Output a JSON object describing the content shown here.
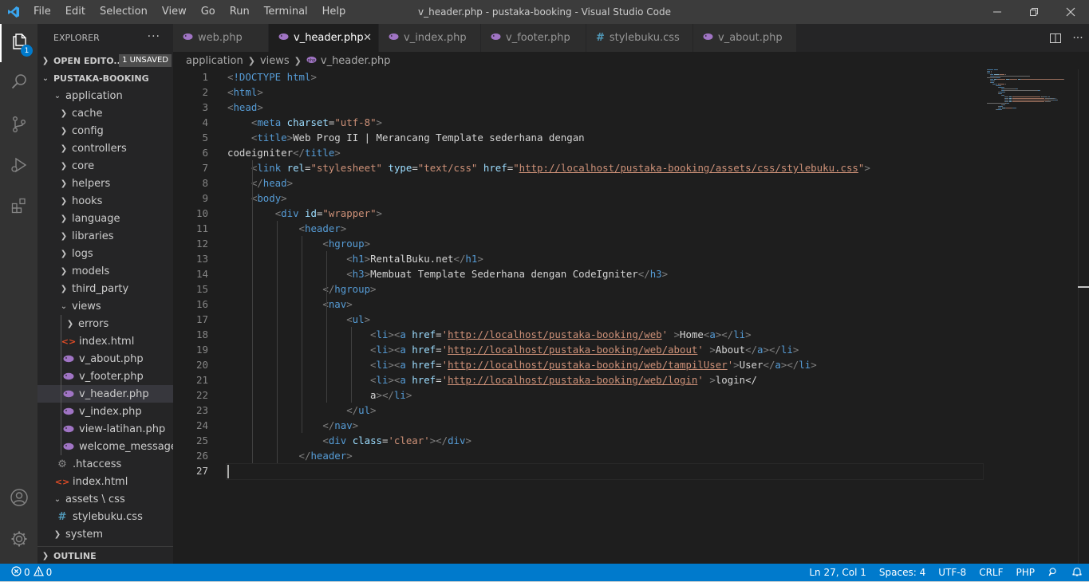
{
  "window": {
    "title": "v_header.php - pustaka-booking - Visual Studio Code",
    "menu": [
      "File",
      "Edit",
      "Selection",
      "View",
      "Go",
      "Run",
      "Terminal",
      "Help"
    ]
  },
  "activity": {
    "explorer_badge": "1"
  },
  "sidebar": {
    "title": "EXPLORER",
    "open_editors": "OPEN EDITO...",
    "unsaved": "1 UNSAVED",
    "project": "PUSTAKA-BOOKING",
    "outline": "OUTLINE",
    "tree": [
      {
        "label": "application",
        "type": "folder-open",
        "depth": 1
      },
      {
        "label": "cache",
        "type": "folder",
        "depth": 2
      },
      {
        "label": "config",
        "type": "folder",
        "depth": 2
      },
      {
        "label": "controllers",
        "type": "folder",
        "depth": 2
      },
      {
        "label": "core",
        "type": "folder",
        "depth": 2
      },
      {
        "label": "helpers",
        "type": "folder",
        "depth": 2
      },
      {
        "label": "hooks",
        "type": "folder",
        "depth": 2
      },
      {
        "label": "language",
        "type": "folder",
        "depth": 2
      },
      {
        "label": "libraries",
        "type": "folder",
        "depth": 2
      },
      {
        "label": "logs",
        "type": "folder",
        "depth": 2
      },
      {
        "label": "models",
        "type": "folder",
        "depth": 2
      },
      {
        "label": "third_party",
        "type": "folder",
        "depth": 2
      },
      {
        "label": "views",
        "type": "folder-open",
        "depth": 2
      },
      {
        "label": "errors",
        "type": "folder",
        "depth": 3
      },
      {
        "label": "index.html",
        "type": "html",
        "depth": 3
      },
      {
        "label": "v_about.php",
        "type": "php",
        "depth": 3
      },
      {
        "label": "v_footer.php",
        "type": "php",
        "depth": 3
      },
      {
        "label": "v_header.php",
        "type": "php",
        "depth": 3,
        "selected": true
      },
      {
        "label": "v_index.php",
        "type": "php",
        "depth": 3
      },
      {
        "label": "view-latihan.php",
        "type": "php",
        "depth": 3
      },
      {
        "label": "welcome_message....",
        "type": "php",
        "depth": 3
      },
      {
        "label": ".htaccess",
        "type": "gear",
        "depth": 2
      },
      {
        "label": "index.html",
        "type": "html",
        "depth": 2
      },
      {
        "label": "assets \\ css",
        "type": "folder-open",
        "depth": 1
      },
      {
        "label": "stylebuku.css",
        "type": "css",
        "depth": 2
      },
      {
        "label": "system",
        "type": "folder",
        "depth": 1
      }
    ]
  },
  "tabs": [
    {
      "label": "web.php",
      "type": "php",
      "width": 120
    },
    {
      "label": "v_header.php",
      "type": "php",
      "width": 138,
      "active": true
    },
    {
      "label": "v_index.php",
      "type": "php",
      "width": 128
    },
    {
      "label": "v_footer.php",
      "type": "php",
      "width": 132
    },
    {
      "label": "stylebuku.css",
      "type": "css",
      "width": 134
    },
    {
      "label": "v_about.php",
      "type": "php",
      "width": 130
    }
  ],
  "breadcrumb": [
    "application",
    "views",
    "v_header.php"
  ],
  "editor": {
    "current_line": 27,
    "lines": [
      [
        [
          "br",
          "<"
        ],
        [
          "tag",
          "!DOCTYPE"
        ],
        [
          "txt",
          " "
        ],
        [
          "tag",
          "html"
        ],
        [
          "br",
          ">"
        ]
      ],
      [
        [
          "br",
          "<"
        ],
        [
          "tag",
          "html"
        ],
        [
          "br",
          ">"
        ]
      ],
      [
        [
          "br",
          "<"
        ],
        [
          "tag",
          "head"
        ],
        [
          "br",
          ">"
        ]
      ],
      [
        [
          "txt",
          "    "
        ],
        [
          "br",
          "<"
        ],
        [
          "tag",
          "meta"
        ],
        [
          "txt",
          " "
        ],
        [
          "attr",
          "charset"
        ],
        [
          "txt",
          "="
        ],
        [
          "str",
          "\"utf-8\""
        ],
        [
          "br",
          ">"
        ]
      ],
      [
        [
          "txt",
          "    "
        ],
        [
          "br",
          "<"
        ],
        [
          "tag",
          "title"
        ],
        [
          "br",
          ">"
        ],
        [
          "txt",
          "Web Prog II | Merancang Template sederhana dengan"
        ]
      ],
      [
        [
          "txt",
          "codeigniter"
        ],
        [
          "br",
          "</"
        ],
        [
          "tag",
          "title"
        ],
        [
          "br",
          ">"
        ]
      ],
      [
        [
          "txt",
          "    "
        ],
        [
          "br",
          "<"
        ],
        [
          "tag",
          "link"
        ],
        [
          "txt",
          " "
        ],
        [
          "attr",
          "rel"
        ],
        [
          "txt",
          "="
        ],
        [
          "str",
          "\"stylesheet\""
        ],
        [
          "txt",
          " "
        ],
        [
          "attr",
          "type"
        ],
        [
          "txt",
          "="
        ],
        [
          "str",
          "\"text/css\""
        ],
        [
          "txt",
          " "
        ],
        [
          "attr",
          "href"
        ],
        [
          "txt",
          "="
        ],
        [
          "str",
          "\""
        ],
        [
          "url",
          "http://localhost/pustaka-booking/assets/css/stylebuku.css"
        ],
        [
          "str",
          "\""
        ],
        [
          "br",
          ">"
        ]
      ],
      [
        [
          "txt",
          "    "
        ],
        [
          "br",
          "</"
        ],
        [
          "tag",
          "head"
        ],
        [
          "br",
          ">"
        ]
      ],
      [
        [
          "txt",
          "    "
        ],
        [
          "br",
          "<"
        ],
        [
          "tag",
          "body"
        ],
        [
          "br",
          ">"
        ]
      ],
      [
        [
          "txt",
          "        "
        ],
        [
          "br",
          "<"
        ],
        [
          "tag",
          "div"
        ],
        [
          "txt",
          " "
        ],
        [
          "attr",
          "id"
        ],
        [
          "txt",
          "="
        ],
        [
          "str",
          "\"wrapper\""
        ],
        [
          "br",
          ">"
        ]
      ],
      [
        [
          "txt",
          "            "
        ],
        [
          "br",
          "<"
        ],
        [
          "tag",
          "header"
        ],
        [
          "br",
          ">"
        ]
      ],
      [
        [
          "txt",
          "                "
        ],
        [
          "br",
          "<"
        ],
        [
          "tag",
          "hgroup"
        ],
        [
          "br",
          ">"
        ]
      ],
      [
        [
          "txt",
          "                    "
        ],
        [
          "br",
          "<"
        ],
        [
          "tag",
          "h1"
        ],
        [
          "br",
          ">"
        ],
        [
          "txt",
          "RentalBuku.net"
        ],
        [
          "br",
          "</"
        ],
        [
          "tag",
          "h1"
        ],
        [
          "br",
          ">"
        ]
      ],
      [
        [
          "txt",
          "                    "
        ],
        [
          "br",
          "<"
        ],
        [
          "tag",
          "h3"
        ],
        [
          "br",
          ">"
        ],
        [
          "txt",
          "Membuat Template Sederhana dengan CodeIgniter"
        ],
        [
          "br",
          "</"
        ],
        [
          "tag",
          "h3"
        ],
        [
          "br",
          ">"
        ]
      ],
      [
        [
          "txt",
          "                "
        ],
        [
          "br",
          "</"
        ],
        [
          "tag",
          "hgroup"
        ],
        [
          "br",
          ">"
        ]
      ],
      [
        [
          "txt",
          "                "
        ],
        [
          "br",
          "<"
        ],
        [
          "tag",
          "nav"
        ],
        [
          "br",
          ">"
        ]
      ],
      [
        [
          "txt",
          "                    "
        ],
        [
          "br",
          "<"
        ],
        [
          "tag",
          "ul"
        ],
        [
          "br",
          ">"
        ]
      ],
      [
        [
          "txt",
          "                        "
        ],
        [
          "br",
          "<"
        ],
        [
          "tag",
          "li"
        ],
        [
          "br",
          "><"
        ],
        [
          "tag",
          "a"
        ],
        [
          "txt",
          " "
        ],
        [
          "attr",
          "href"
        ],
        [
          "txt",
          "="
        ],
        [
          "str",
          "'"
        ],
        [
          "url",
          "http://localhost/pustaka-booking/web"
        ],
        [
          "str",
          "'"
        ],
        [
          "txt",
          " "
        ],
        [
          "br",
          ">"
        ],
        [
          "txt",
          "Home"
        ],
        [
          "br",
          "<"
        ],
        [
          "tag",
          "a"
        ],
        [
          "br",
          "></"
        ],
        [
          "tag",
          "li"
        ],
        [
          "br",
          ">"
        ]
      ],
      [
        [
          "txt",
          "                        "
        ],
        [
          "br",
          "<"
        ],
        [
          "tag",
          "li"
        ],
        [
          "br",
          "><"
        ],
        [
          "tag",
          "a"
        ],
        [
          "txt",
          " "
        ],
        [
          "attr",
          "href"
        ],
        [
          "txt",
          "="
        ],
        [
          "str",
          "'"
        ],
        [
          "url",
          "http://localhost/pustaka-booking/web/about"
        ],
        [
          "str",
          "'"
        ],
        [
          "txt",
          " "
        ],
        [
          "br",
          ">"
        ],
        [
          "txt",
          "About"
        ],
        [
          "br",
          "</"
        ],
        [
          "tag",
          "a"
        ],
        [
          "br",
          "></"
        ],
        [
          "tag",
          "li"
        ],
        [
          "br",
          ">"
        ]
      ],
      [
        [
          "txt",
          "                        "
        ],
        [
          "br",
          "<"
        ],
        [
          "tag",
          "li"
        ],
        [
          "br",
          "><"
        ],
        [
          "tag",
          "a"
        ],
        [
          "txt",
          " "
        ],
        [
          "attr",
          "href"
        ],
        [
          "txt",
          "="
        ],
        [
          "str",
          "'"
        ],
        [
          "url",
          "http://localhost/pustaka-booking/web/tampilUser"
        ],
        [
          "str",
          "'"
        ],
        [
          "br",
          ">"
        ],
        [
          "txt",
          "User"
        ],
        [
          "br",
          "</"
        ],
        [
          "tag",
          "a"
        ],
        [
          "br",
          "></"
        ],
        [
          "tag",
          "li"
        ],
        [
          "br",
          ">"
        ]
      ],
      [
        [
          "txt",
          "                        "
        ],
        [
          "br",
          "<"
        ],
        [
          "tag",
          "li"
        ],
        [
          "br",
          "><"
        ],
        [
          "tag",
          "a"
        ],
        [
          "txt",
          " "
        ],
        [
          "attr",
          "href"
        ],
        [
          "txt",
          "="
        ],
        [
          "str",
          "'"
        ],
        [
          "url",
          "http://localhost/pustaka-booking/web/login"
        ],
        [
          "str",
          "'"
        ],
        [
          "txt",
          " "
        ],
        [
          "br",
          ">"
        ],
        [
          "txt",
          "login</"
        ]
      ],
      [
        [
          "txt",
          "                        a"
        ],
        [
          "br",
          ">"
        ],
        [
          "br",
          "</"
        ],
        [
          "tag",
          "li"
        ],
        [
          "br",
          ">"
        ]
      ],
      [
        [
          "txt",
          "                    "
        ],
        [
          "br",
          "</"
        ],
        [
          "tag",
          "ul"
        ],
        [
          "br",
          ">"
        ]
      ],
      [
        [
          "txt",
          "                "
        ],
        [
          "br",
          "</"
        ],
        [
          "tag",
          "nav"
        ],
        [
          "br",
          ">"
        ]
      ],
      [
        [
          "txt",
          "                "
        ],
        [
          "br",
          "<"
        ],
        [
          "tag",
          "div"
        ],
        [
          "txt",
          " "
        ],
        [
          "attr",
          "class"
        ],
        [
          "txt",
          "="
        ],
        [
          "str",
          "'clear'"
        ],
        [
          "br",
          "></"
        ],
        [
          "tag",
          "div"
        ],
        [
          "br",
          ">"
        ]
      ],
      [
        [
          "txt",
          "            "
        ],
        [
          "br",
          "</"
        ],
        [
          "tag",
          "header"
        ],
        [
          "br",
          ">"
        ]
      ],
      [
        [
          "txt",
          ""
        ]
      ]
    ]
  },
  "status": {
    "errors": "0",
    "warnings": "0",
    "position": "Ln 27, Col 1",
    "spaces": "Spaces: 4",
    "encoding": "UTF-8",
    "eol": "CRLF",
    "language": "PHP"
  },
  "colors": {
    "accent": "#007acc",
    "php_icon": "#a074c4",
    "css_icon": "#519aba",
    "html_icon": "#e44d26"
  }
}
